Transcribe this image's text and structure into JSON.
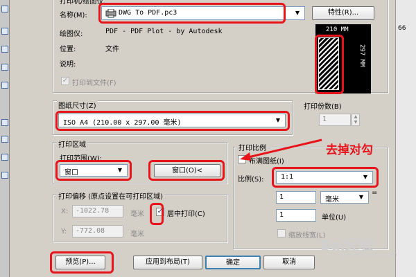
{
  "printer": {
    "group_title": "打印机/绘图仪",
    "name_label": "名称(M):",
    "name_value": "DWG To PDF.pc3",
    "properties_button": "特性(R)...",
    "plotter_label": "绘图仪:",
    "plotter_value": "PDF - PDF Plot - by Autodesk",
    "location_label": "位置:",
    "location_value": "文件",
    "description_label": "说明:",
    "print_to_file_label": "打印到文件(F)",
    "print_to_file_checked": true
  },
  "paper_preview": {
    "width_label": "210 MM",
    "height_label": "297 MM"
  },
  "paper_size": {
    "title": "图纸尺寸(Z)",
    "value": "ISO A4 (210.00 x 297.00 毫米)"
  },
  "copies": {
    "title": "打印份数(B)",
    "value": "1"
  },
  "plot_area": {
    "group_title": "打印区域",
    "range_label": "打印范围(W):",
    "range_value": "窗口",
    "window_button": "窗口(O)<"
  },
  "plot_scale": {
    "group_title": "打印比例",
    "fit_label": "布满图纸(I)",
    "fit_checked": false,
    "scale_label": "比例(S):",
    "scale_value": "1:1",
    "value1": "1",
    "unit1": "毫米",
    "value2": "1",
    "unit2_label": "单位(U)",
    "lineweight_label": "缩放线宽(L)"
  },
  "plot_offset": {
    "group_title": "打印偏移 (原点设置在可打印区域)",
    "x_label": "X:",
    "x_value": "-1022.78",
    "y_label": "Y:",
    "y_value": "-772.08",
    "unit": "毫米",
    "center_label": "居中打印(C)",
    "center_checked": true
  },
  "buttons": {
    "preview": "预览(P)...",
    "apply": "应用到布局(T)",
    "ok": "确定",
    "cancel": "取消"
  },
  "annotation": "去掉对勾",
  "background_text": "66",
  "watermark": {
    "brand": "Bai经验",
    "url": "jingyan.baidu.com"
  },
  "colors": {
    "highlight": "#e8141c",
    "dialog_bg": "#d4d0c8"
  }
}
